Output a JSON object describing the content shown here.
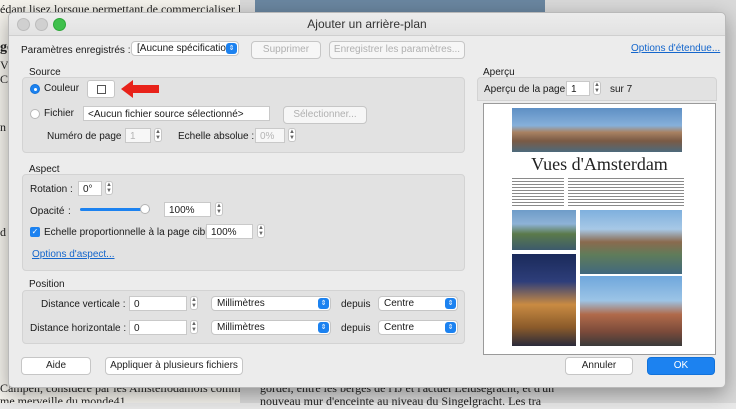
{
  "background": {
    "left_lines": [
      "édant lisez lorsque permettant de commercialiser le",
      "ges",
      "V",
      "C",
      "n",
      "d",
      "Campen, considéré par les Amstellodamois comme la",
      "me merveille du monde41"
    ],
    "right_lines": [
      "gordel, entre les berges de l'IJ et l'actuel Leidsegracht, et d'un",
      "nouveau mur d'enceinte au niveau du Singelgracht. Les tra"
    ]
  },
  "dialog": {
    "title": "Ajouter un arrière-plan",
    "saved_settings_label": "Paramètres enregistrés :",
    "saved_settings_value": "[Aucune spécification]",
    "delete_button": "Supprimer",
    "save_settings_button": "Enregistrer les paramètres...",
    "advanced_options_link": "Options d'étendue...",
    "source": {
      "heading": "Source",
      "color_label": "Couleur",
      "file_label": "Fichier",
      "file_value": "<Aucun fichier source sélectionné>",
      "select_button": "Sélectionner...",
      "page_number_label": "Numéro de page :",
      "page_number_value": "1",
      "absolute_scale_label": "Echelle absolue :",
      "absolute_scale_value": "0%"
    },
    "aspect": {
      "heading": "Aspect",
      "rotation_label": "Rotation :",
      "rotation_value": "0°",
      "opacity_label": "Opacité",
      "opacity_value": "100%",
      "opacity_fraction": 1.0,
      "proportional_label": "Echelle proportionnelle à la page cible",
      "proportional_value": "100%",
      "options_link": "Options d'aspect..."
    },
    "position": {
      "heading": "Position",
      "vertical_label": "Distance verticale :",
      "vertical_value": "0",
      "vertical_unit": "Millimètres",
      "vertical_from_label": "depuis",
      "vertical_from": "Centre",
      "horizontal_label": "Distance horizontale :",
      "horizontal_value": "0",
      "horizontal_unit": "Millimètres",
      "horizontal_from_label": "depuis",
      "horizontal_from": "Centre"
    },
    "preview": {
      "heading": "Aperçu",
      "page_label": "Aperçu de la page",
      "page_value": "1",
      "page_total": "sur 7",
      "doc_title": "Vues d'Amsterdam"
    },
    "help_button": "Aide",
    "apply_multiple_button": "Appliquer à plusieurs fichiers",
    "cancel_button": "Annuler",
    "ok_button": "OK",
    "colors": {
      "accent": "#1c82f0",
      "arrow": "#e8221a"
    }
  }
}
